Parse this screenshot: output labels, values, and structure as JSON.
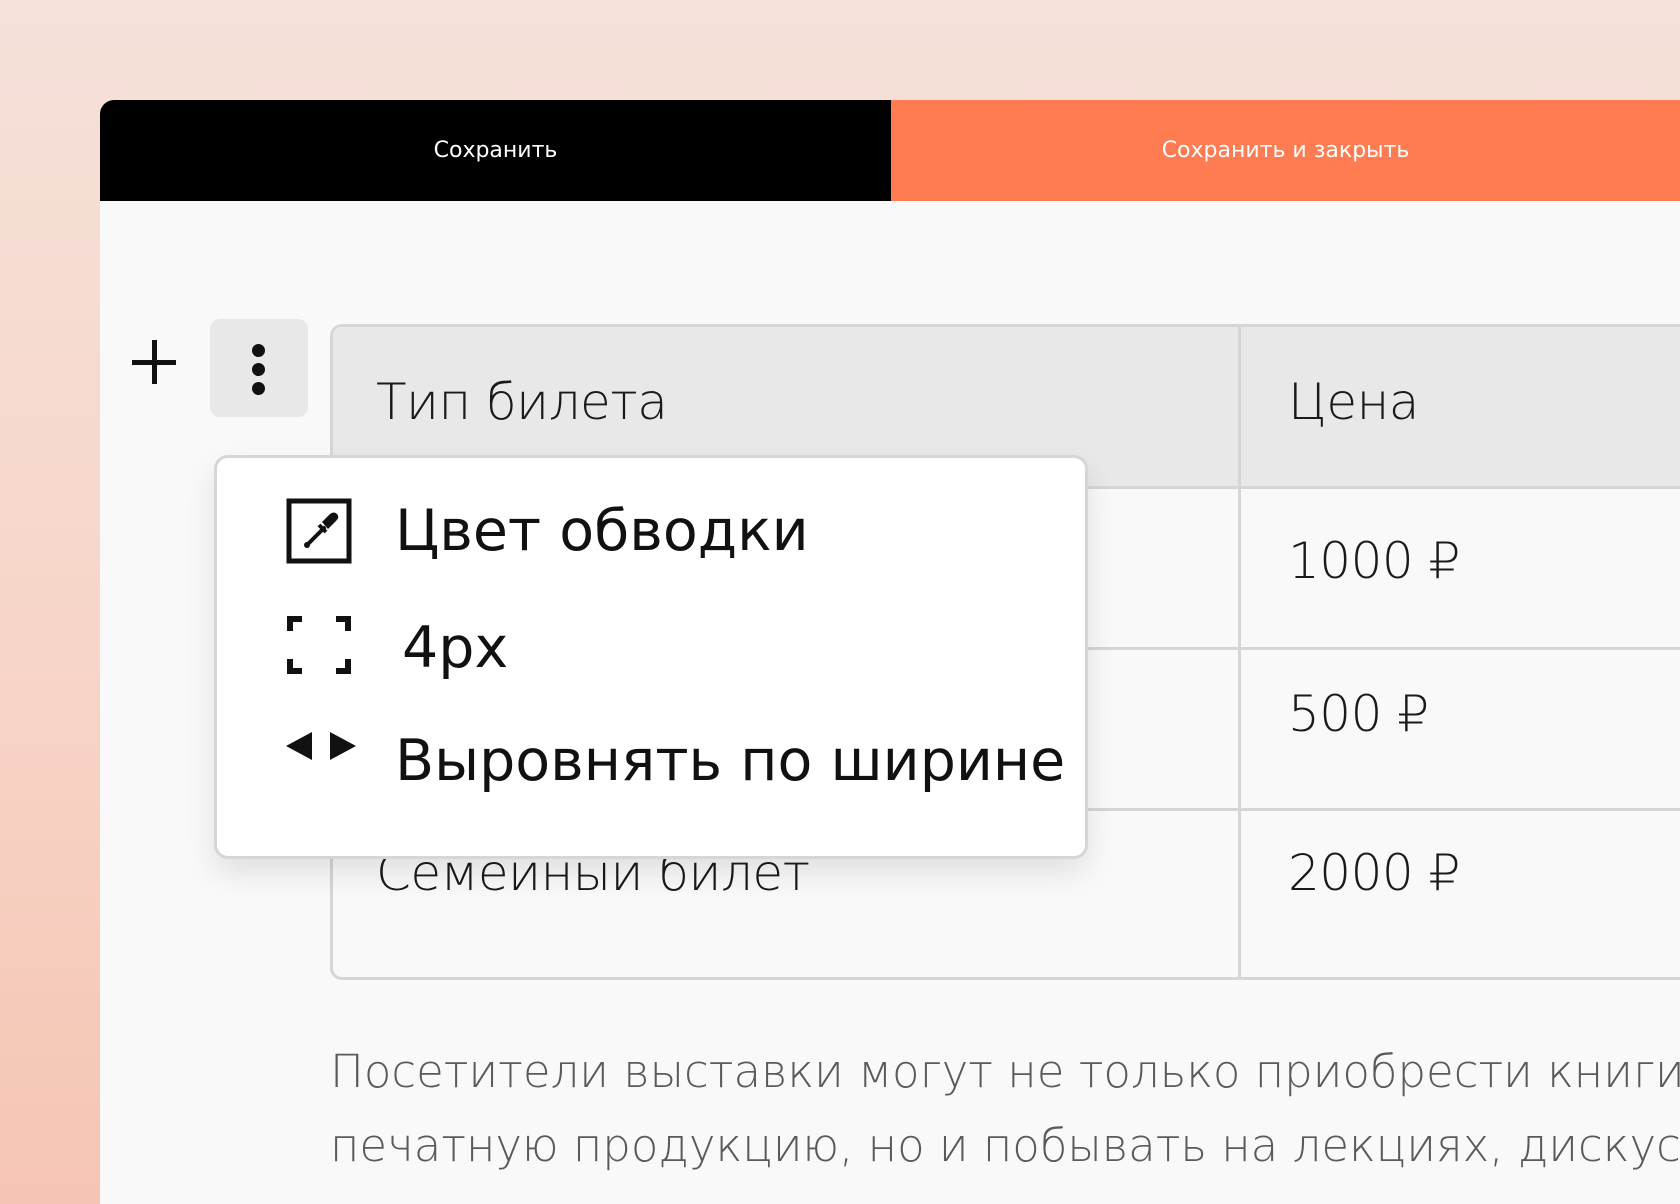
{
  "toolbar": {
    "save_label": "Сохранить",
    "save_close_label": "Сохранить и закрыть"
  },
  "colors": {
    "save_bg": "#000000",
    "save_close_bg": "#ff7b51",
    "header_bg": "#e8e8e8",
    "border": "#d6d6d6"
  },
  "block_controls": {
    "add_icon": "plus-icon",
    "more_icon": "vertical-dots-icon"
  },
  "table": {
    "headers": [
      "Тип билета",
      "Цена"
    ],
    "rows": [
      [
        "",
        "1000 ₽"
      ],
      [
        "",
        "500 ₽"
      ],
      [
        "Семейный билет",
        "2000 ₽"
      ]
    ]
  },
  "menu": {
    "items": [
      {
        "label": "Цвет обводки",
        "icon": "eyedropper-icon"
      },
      {
        "label": "4px",
        "icon": "border-width-icon"
      },
      {
        "label": "Выровнять по ширине",
        "icon": "stretch-horizontal-icon"
      }
    ]
  },
  "paragraph": {
    "lines": [
      "Посетители выставки могут не только приобрести книги и дру",
      "печатную продукцию, но и побывать на лекциях, дискуссиях,"
    ]
  }
}
